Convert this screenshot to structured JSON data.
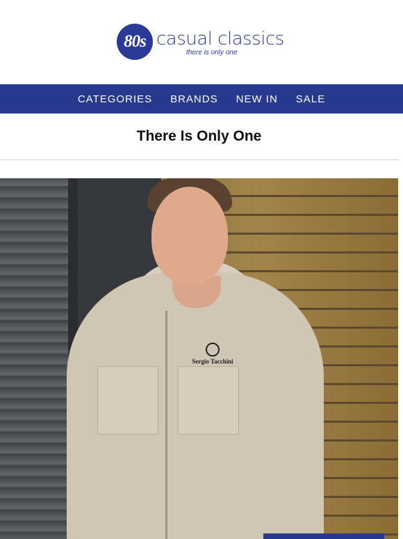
{
  "header": {
    "logo": {
      "badge_text": "80s",
      "name": "casual classics",
      "tagline": "there is only one"
    }
  },
  "nav": {
    "items": [
      {
        "label": "CATEGORIES"
      },
      {
        "label": "BRANDS"
      },
      {
        "label": "NEW IN"
      },
      {
        "label": "SALE"
      }
    ]
  },
  "banner": {
    "tagline": "There Is Only One"
  },
  "hero": {
    "jacket_brand": "Sergio Tacchini"
  },
  "colors": {
    "brand_blue": "#27398f",
    "jacket": "#cfc6b4"
  }
}
